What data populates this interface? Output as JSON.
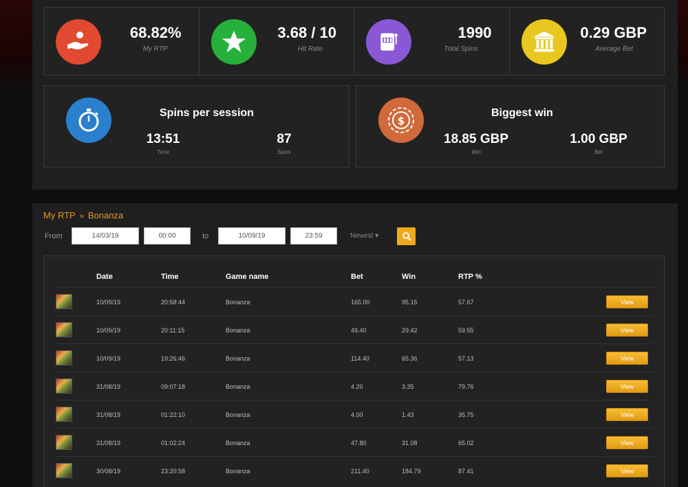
{
  "stats": [
    {
      "value": "68.82%",
      "label": "My RTP",
      "icon": "hand-coin-icon",
      "color": "#e14a30"
    },
    {
      "value": "3.68 / 10",
      "label": "Hit Rate",
      "icon": "star-icon",
      "color": "#27b13c"
    },
    {
      "value": "1990",
      "label": "Total Spins",
      "icon": "slot-machine-icon",
      "color": "#8a58d6"
    },
    {
      "value": "0.29 GBP",
      "label": "Average Bet",
      "icon": "bank-building-icon",
      "color": "#e8c820"
    }
  ],
  "session": {
    "title": "Spins per session",
    "time_value": "13:51",
    "time_label": "Time",
    "spins_value": "87",
    "spins_label": "Spins",
    "icon": "stopwatch-icon",
    "color": "#2a7fce"
  },
  "biggest": {
    "title": "Biggest win",
    "win_value": "18.85 GBP",
    "win_label": "Win",
    "bet_value": "1.00 GBP",
    "bet_label": "Bet",
    "icon": "casino-chip-icon",
    "color": "#d1693a"
  },
  "breadcrumb": {
    "root": "My RTP",
    "sep": "»",
    "current": "Bonanza"
  },
  "filter": {
    "from_label": "From",
    "from_date": "14/03/19",
    "from_time": "00:00",
    "to_label": "to",
    "to_date": "10/09/19",
    "to_time": "23:59",
    "sort": "Newest ▾"
  },
  "table": {
    "headers": [
      "Date",
      "Time",
      "Game name",
      "Bet",
      "Win",
      "RTP %"
    ],
    "view_label": "View",
    "rows": [
      {
        "date": "10/09/19",
        "time": "20:58:44",
        "game": "Bonanza",
        "bet": "165.00",
        "win": "95.15",
        "rtp": "57.67"
      },
      {
        "date": "10/09/19",
        "time": "20:11:15",
        "game": "Bonanza",
        "bet": "49.40",
        "win": "29.42",
        "rtp": "59.55"
      },
      {
        "date": "10/09/19",
        "time": "19:26:46",
        "game": "Bonanza",
        "bet": "114.40",
        "win": "65.36",
        "rtp": "57.13"
      },
      {
        "date": "31/08/19",
        "time": "09:07:18",
        "game": "Bonanza",
        "bet": "4.20",
        "win": "3.35",
        "rtp": "79.76"
      },
      {
        "date": "31/08/19",
        "time": "01:22:10",
        "game": "Bonanza",
        "bet": "4.00",
        "win": "1.43",
        "rtp": "35.75"
      },
      {
        "date": "31/08/19",
        "time": "01:02:24",
        "game": "Bonanza",
        "bet": "47.80",
        "win": "31.08",
        "rtp": "65.02"
      },
      {
        "date": "30/08/19",
        "time": "23:20:58",
        "game": "Bonanza",
        "bet": "211.40",
        "win": "184.79",
        "rtp": "87.41"
      }
    ]
  }
}
